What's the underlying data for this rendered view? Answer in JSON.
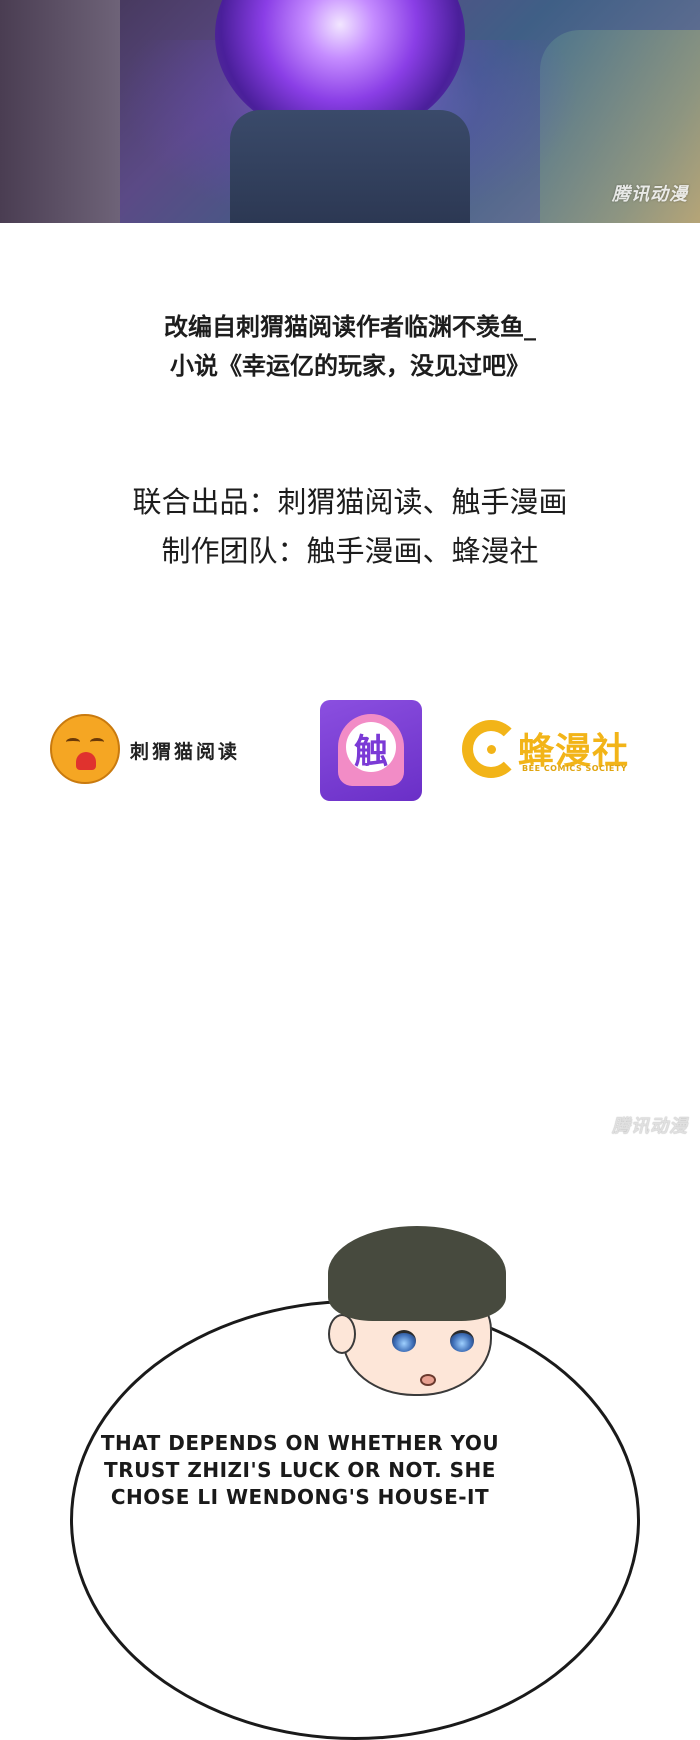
{
  "watermark": "腾讯动漫",
  "credits": {
    "adapted_line1": "改编自刺猬猫阅读作者临渊不羡鱼_",
    "adapted_line2": "小说《幸运亿的玩家，没见过吧》",
    "joint_production": "联合出品：刺猬猫阅读、触手漫画",
    "production_team": "制作团队：触手漫画、蜂漫社"
  },
  "logos": {
    "hedgehog_name": "刺猬猫阅读",
    "chushou_glyph": "触",
    "bee_name_cn": "蜂漫社",
    "bee_name_en": "BEE COMICS SOCIETY"
  },
  "speech": {
    "line1": "THAT DEPENDS ON WHETHER YOU",
    "line2": "TRUST ZHIZI'S LUCK OR NOT. SHE",
    "line3": "CHOSE LI WENDONG'S HOUSE-IT"
  },
  "colors": {
    "orb_purple": "#8a3ee6",
    "bee_yellow": "#f2b418",
    "hedgehog_orange": "#f5a623",
    "chushou_purple": "#7b3ad6"
  },
  "icons": [
    "cat-logo-icon",
    "chushou-logo-icon",
    "bee-logo-icon"
  ]
}
